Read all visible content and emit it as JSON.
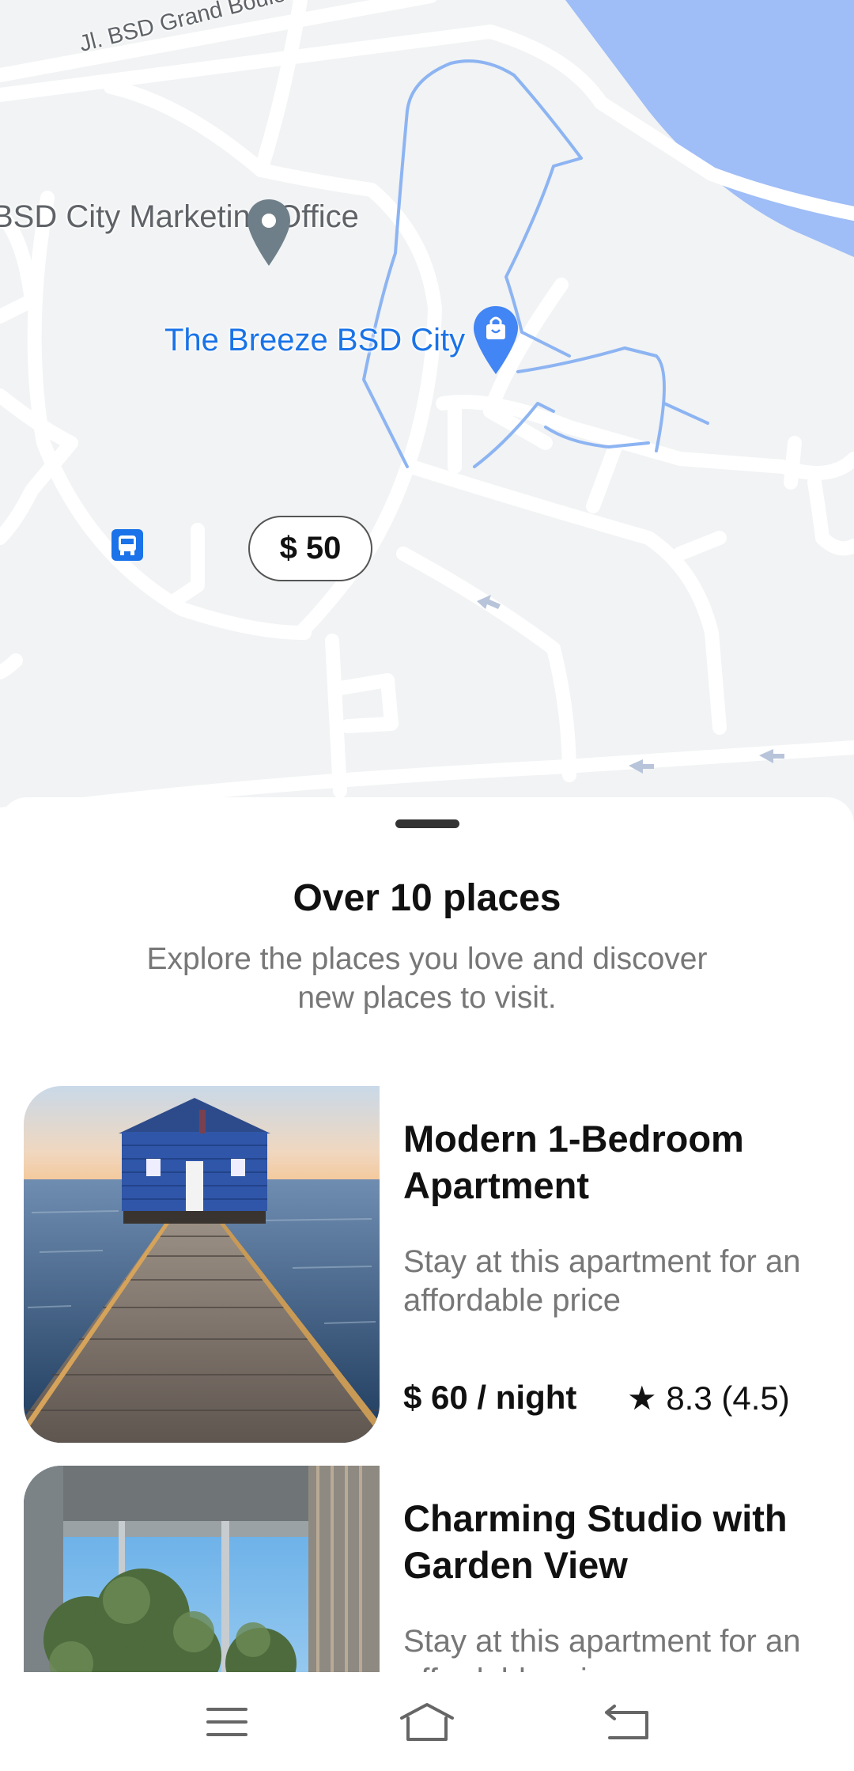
{
  "map": {
    "road_label": "Jl. BSD Grand Boulevard",
    "office_label": "BSD City Marketing Office",
    "mall_label": "The Breeze BSD City",
    "price_marker": "$ 50",
    "icons": [
      "location-pin-icon",
      "shopping-bag-pin-icon",
      "bus-stop-icon"
    ],
    "colors": {
      "water": "#9fbdf6",
      "road": "#ffffff",
      "path": "#8db4f2",
      "mall": "#1a73e8",
      "pin": "#6f7f89"
    }
  },
  "sheet": {
    "title": "Over 10 places",
    "subtitle": "Explore the places you love and discover new places to visit."
  },
  "listings": [
    {
      "title": "Modern 1-Bedroom Apartment",
      "description": "Stay at this apartment for an affordable price",
      "price": "$ 60 / night",
      "rating": "★ 8.3 (4.5)"
    },
    {
      "title": "Charming Studio with Garden View",
      "description": "Stay at this apartment for an affordable price"
    }
  ],
  "navbar": {
    "icons": [
      "menu-icon",
      "home-icon",
      "back-icon"
    ]
  }
}
